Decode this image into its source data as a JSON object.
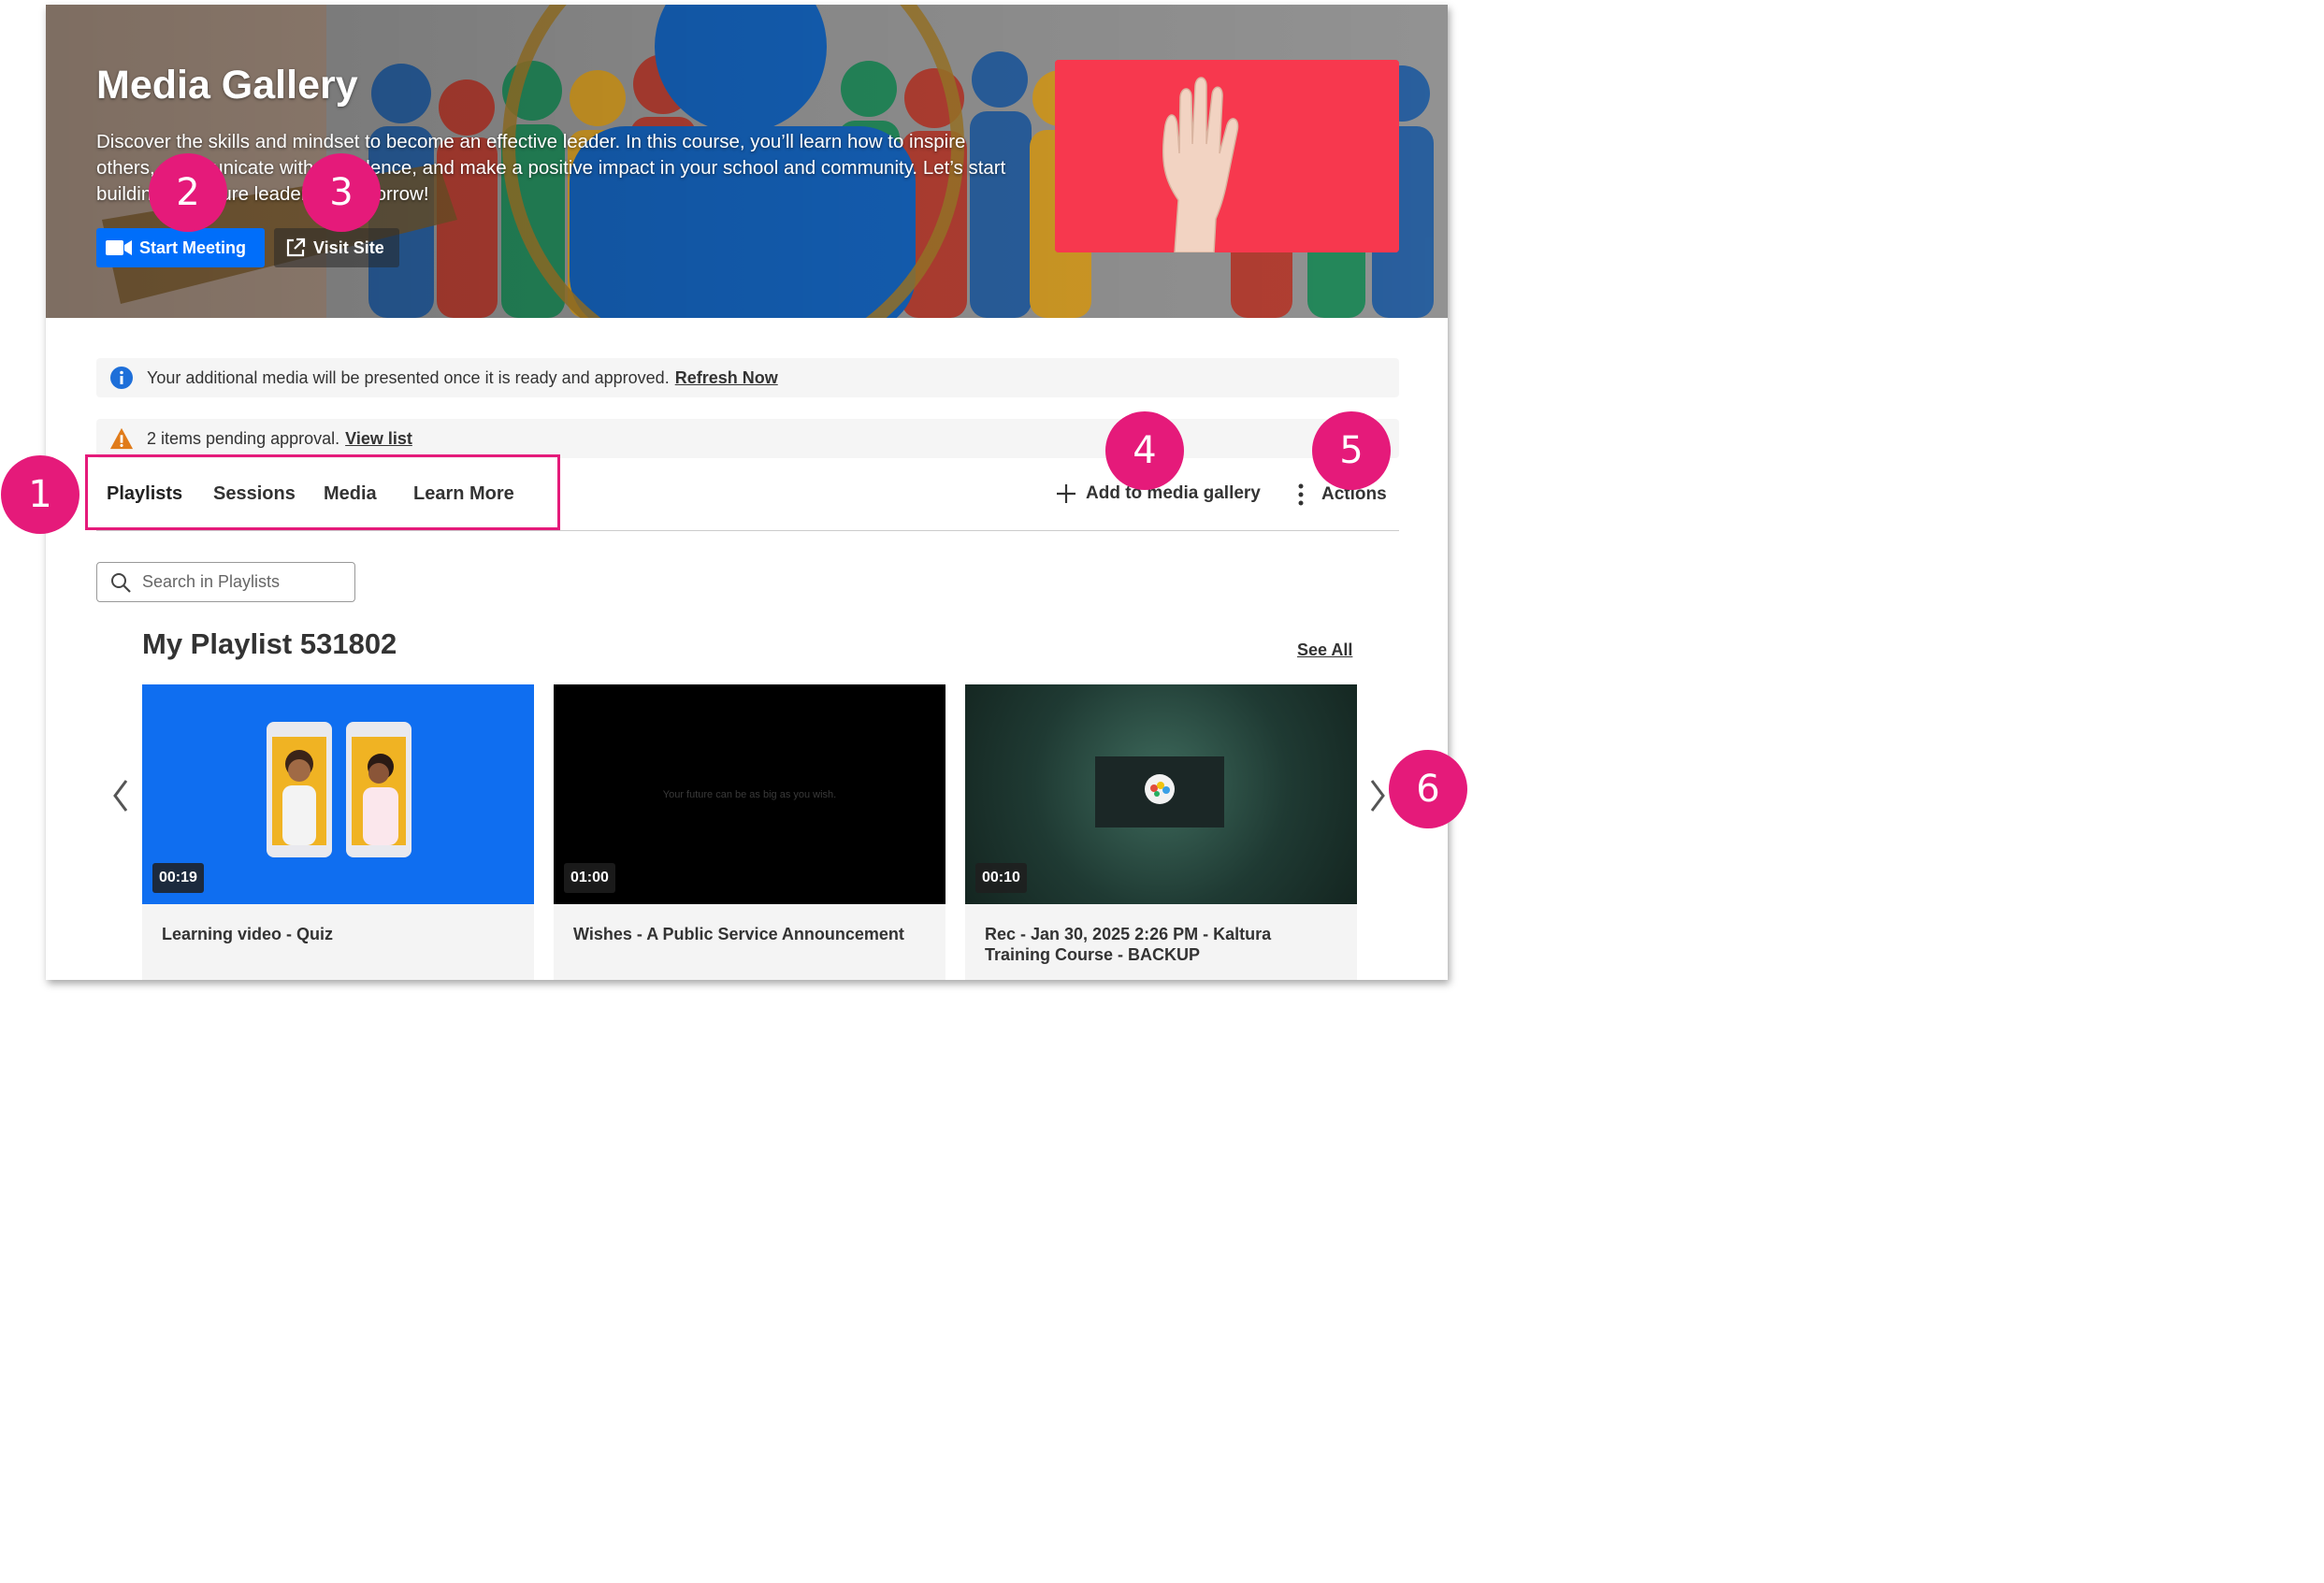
{
  "hero": {
    "title": "Media Gallery",
    "description": "Discover the skills and mindset to become an effective leader. In this course, you’ll learn how to inspire others, communicate with confidence, and make a positive impact in your school and community. Let’s start building the future leaders of tomorrow!",
    "start_meeting_label": "Start Meeting",
    "visit_site_label": "Visit Site",
    "accent_color": "#006efa"
  },
  "alerts": {
    "info_text": "Your additional media will be presented once it is ready and approved.",
    "info_link": "Refresh Now",
    "warn_text": "2 items pending approval.",
    "warn_link": "View list"
  },
  "tabs": {
    "items": [
      "Playlists",
      "Sessions",
      "Media",
      "Learn More"
    ],
    "active": "Playlists",
    "add_label": "Add to media gallery",
    "actions_label": "Actions"
  },
  "search": {
    "placeholder": "Search in Playlists"
  },
  "playlist": {
    "title": "My Playlist 531802",
    "see_all": "See All",
    "cards": [
      {
        "duration": "00:19",
        "title": "Learning video - Quiz"
      },
      {
        "duration": "01:00",
        "title": "Wishes - A Public Service Announcement",
        "thumb_text": "Your future can be as big as you wish."
      },
      {
        "duration": "00:10",
        "title": "Rec - Jan 30, 2025 2:26 PM - Kaltura Training Course - BACKUP"
      }
    ]
  },
  "callouts": [
    "1",
    "2",
    "3",
    "4",
    "5",
    "6"
  ]
}
